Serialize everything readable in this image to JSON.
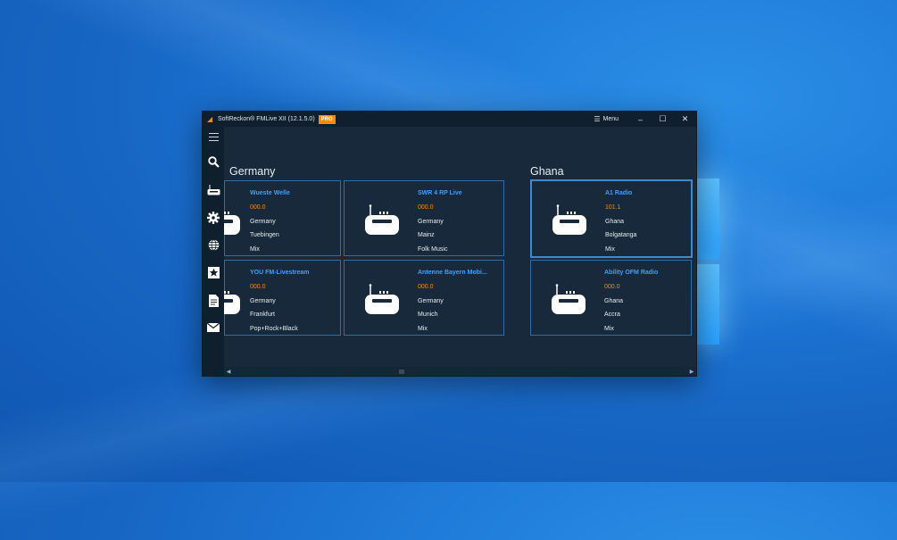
{
  "window": {
    "title": "SoftReckon® FMLive XII (12.1.5.0)",
    "badge": "PRO",
    "menu_label": "Menu",
    "minimize": "–",
    "maximize": "☐",
    "close": "✕"
  },
  "groups": [
    {
      "name": "Germany",
      "stations": [
        {
          "name": "Wueste Welle",
          "frequency": "000.0",
          "country": "Germany",
          "city": "Tuebingen",
          "genre": "Mix"
        },
        {
          "name": "SWR 4 RP Live",
          "frequency": "000.0",
          "country": "Germany",
          "city": "Mainz",
          "genre": "Folk Music"
        },
        {
          "name": "YOU FM-Livestream",
          "frequency": "000.0",
          "country": "Germany",
          "city": "Frankfurt",
          "genre": "Pop+Rock+Black"
        },
        {
          "name": "Antenne Bayern Mobi...",
          "frequency": "000.0",
          "country": "Germany",
          "city": "Munich",
          "genre": "Mix"
        }
      ]
    },
    {
      "name": "Ghana",
      "stations": [
        {
          "name": "A1 Radio",
          "frequency": "101.1",
          "country": "Ghana",
          "city": "Bolgatanga",
          "genre": "Mix"
        },
        {
          "name": "Ability OFM Radio",
          "frequency": "000.0",
          "country": "Ghana",
          "city": "Accra",
          "genre": "Mix"
        }
      ]
    }
  ],
  "sidebar": [
    "hamburger-icon",
    "search-icon",
    "radio-tuner-icon",
    "gear-icon",
    "globe-icon",
    "star-icon",
    "document-icon",
    "mail-icon"
  ],
  "colors": {
    "accent": "#3ea0ff",
    "frequency": "#ff8a00",
    "window_bg": "#17293a",
    "card_border": "#2c6fa8"
  }
}
